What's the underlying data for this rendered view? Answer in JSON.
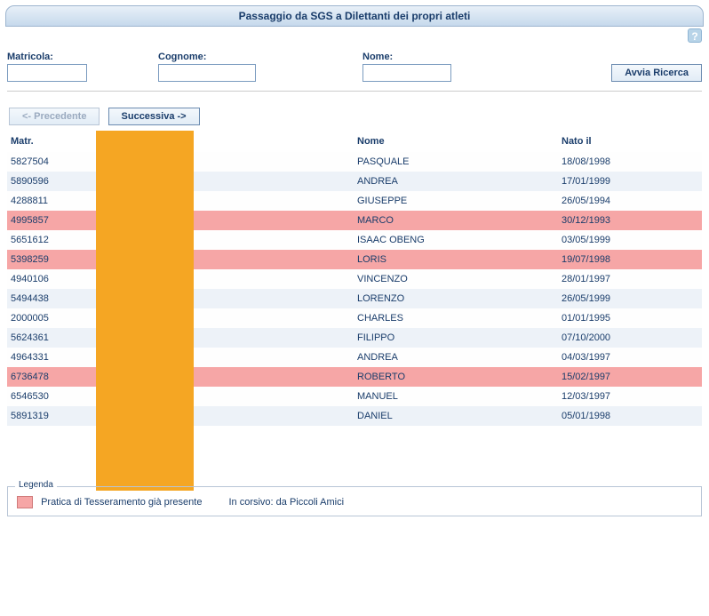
{
  "header": {
    "title": "Passaggio da SGS a Dilettanti dei propri atleti",
    "help": "?"
  },
  "search": {
    "matricola_label": "Matricola:",
    "cognome_label": "Cognome:",
    "nome_label": "Nome:",
    "matricola_value": "",
    "cognome_value": "",
    "nome_value": "",
    "submit_label": "Avvia Ricerca"
  },
  "pager": {
    "prev_label": "<- Precedente",
    "next_label": "Successiva ->"
  },
  "table": {
    "headers": {
      "matr": "Matr.",
      "cognome": "",
      "nome": "Nome",
      "nato": "Nato il"
    },
    "rows": [
      {
        "matr": "5827504",
        "nome": "PASQUALE",
        "nato": "18/08/1998",
        "hl": false
      },
      {
        "matr": "5890596",
        "nome": "ANDREA",
        "nato": "17/01/1999",
        "hl": false
      },
      {
        "matr": "4288811",
        "nome": "GIUSEPPE",
        "nato": "26/05/1994",
        "hl": false
      },
      {
        "matr": "4995857",
        "nome": "MARCO",
        "nato": "30/12/1993",
        "hl": true
      },
      {
        "matr": "5651612",
        "nome": "ISAAC OBENG",
        "nato": "03/05/1999",
        "hl": false
      },
      {
        "matr": "5398259",
        "nome": "LORIS",
        "nato": "19/07/1998",
        "hl": true
      },
      {
        "matr": "4940106",
        "nome": "VINCENZO",
        "nato": "28/01/1997",
        "hl": false
      },
      {
        "matr": "5494438",
        "nome": "LORENZO",
        "nato": "26/05/1999",
        "hl": false
      },
      {
        "matr": "2000005",
        "nome": "CHARLES",
        "nato": "01/01/1995",
        "hl": false
      },
      {
        "matr": "5624361",
        "nome": "FILIPPO",
        "nato": "07/10/2000",
        "hl": false
      },
      {
        "matr": "4964331",
        "nome": "ANDREA",
        "nato": "04/03/1997",
        "hl": false
      },
      {
        "matr": "6736478",
        "nome": "ROBERTO",
        "nato": "15/02/1997",
        "hl": true
      },
      {
        "matr": "6546530",
        "nome": "MANUEL",
        "nato": "12/03/1997",
        "hl": false
      },
      {
        "matr": "5891319",
        "nome": "DANIEL",
        "nato": "05/01/1998",
        "hl": false
      }
    ]
  },
  "legend": {
    "title": "Legenda",
    "item1": "Pratica di Tesseramento già presente",
    "item2": "In corsivo: da Piccoli Amici"
  }
}
